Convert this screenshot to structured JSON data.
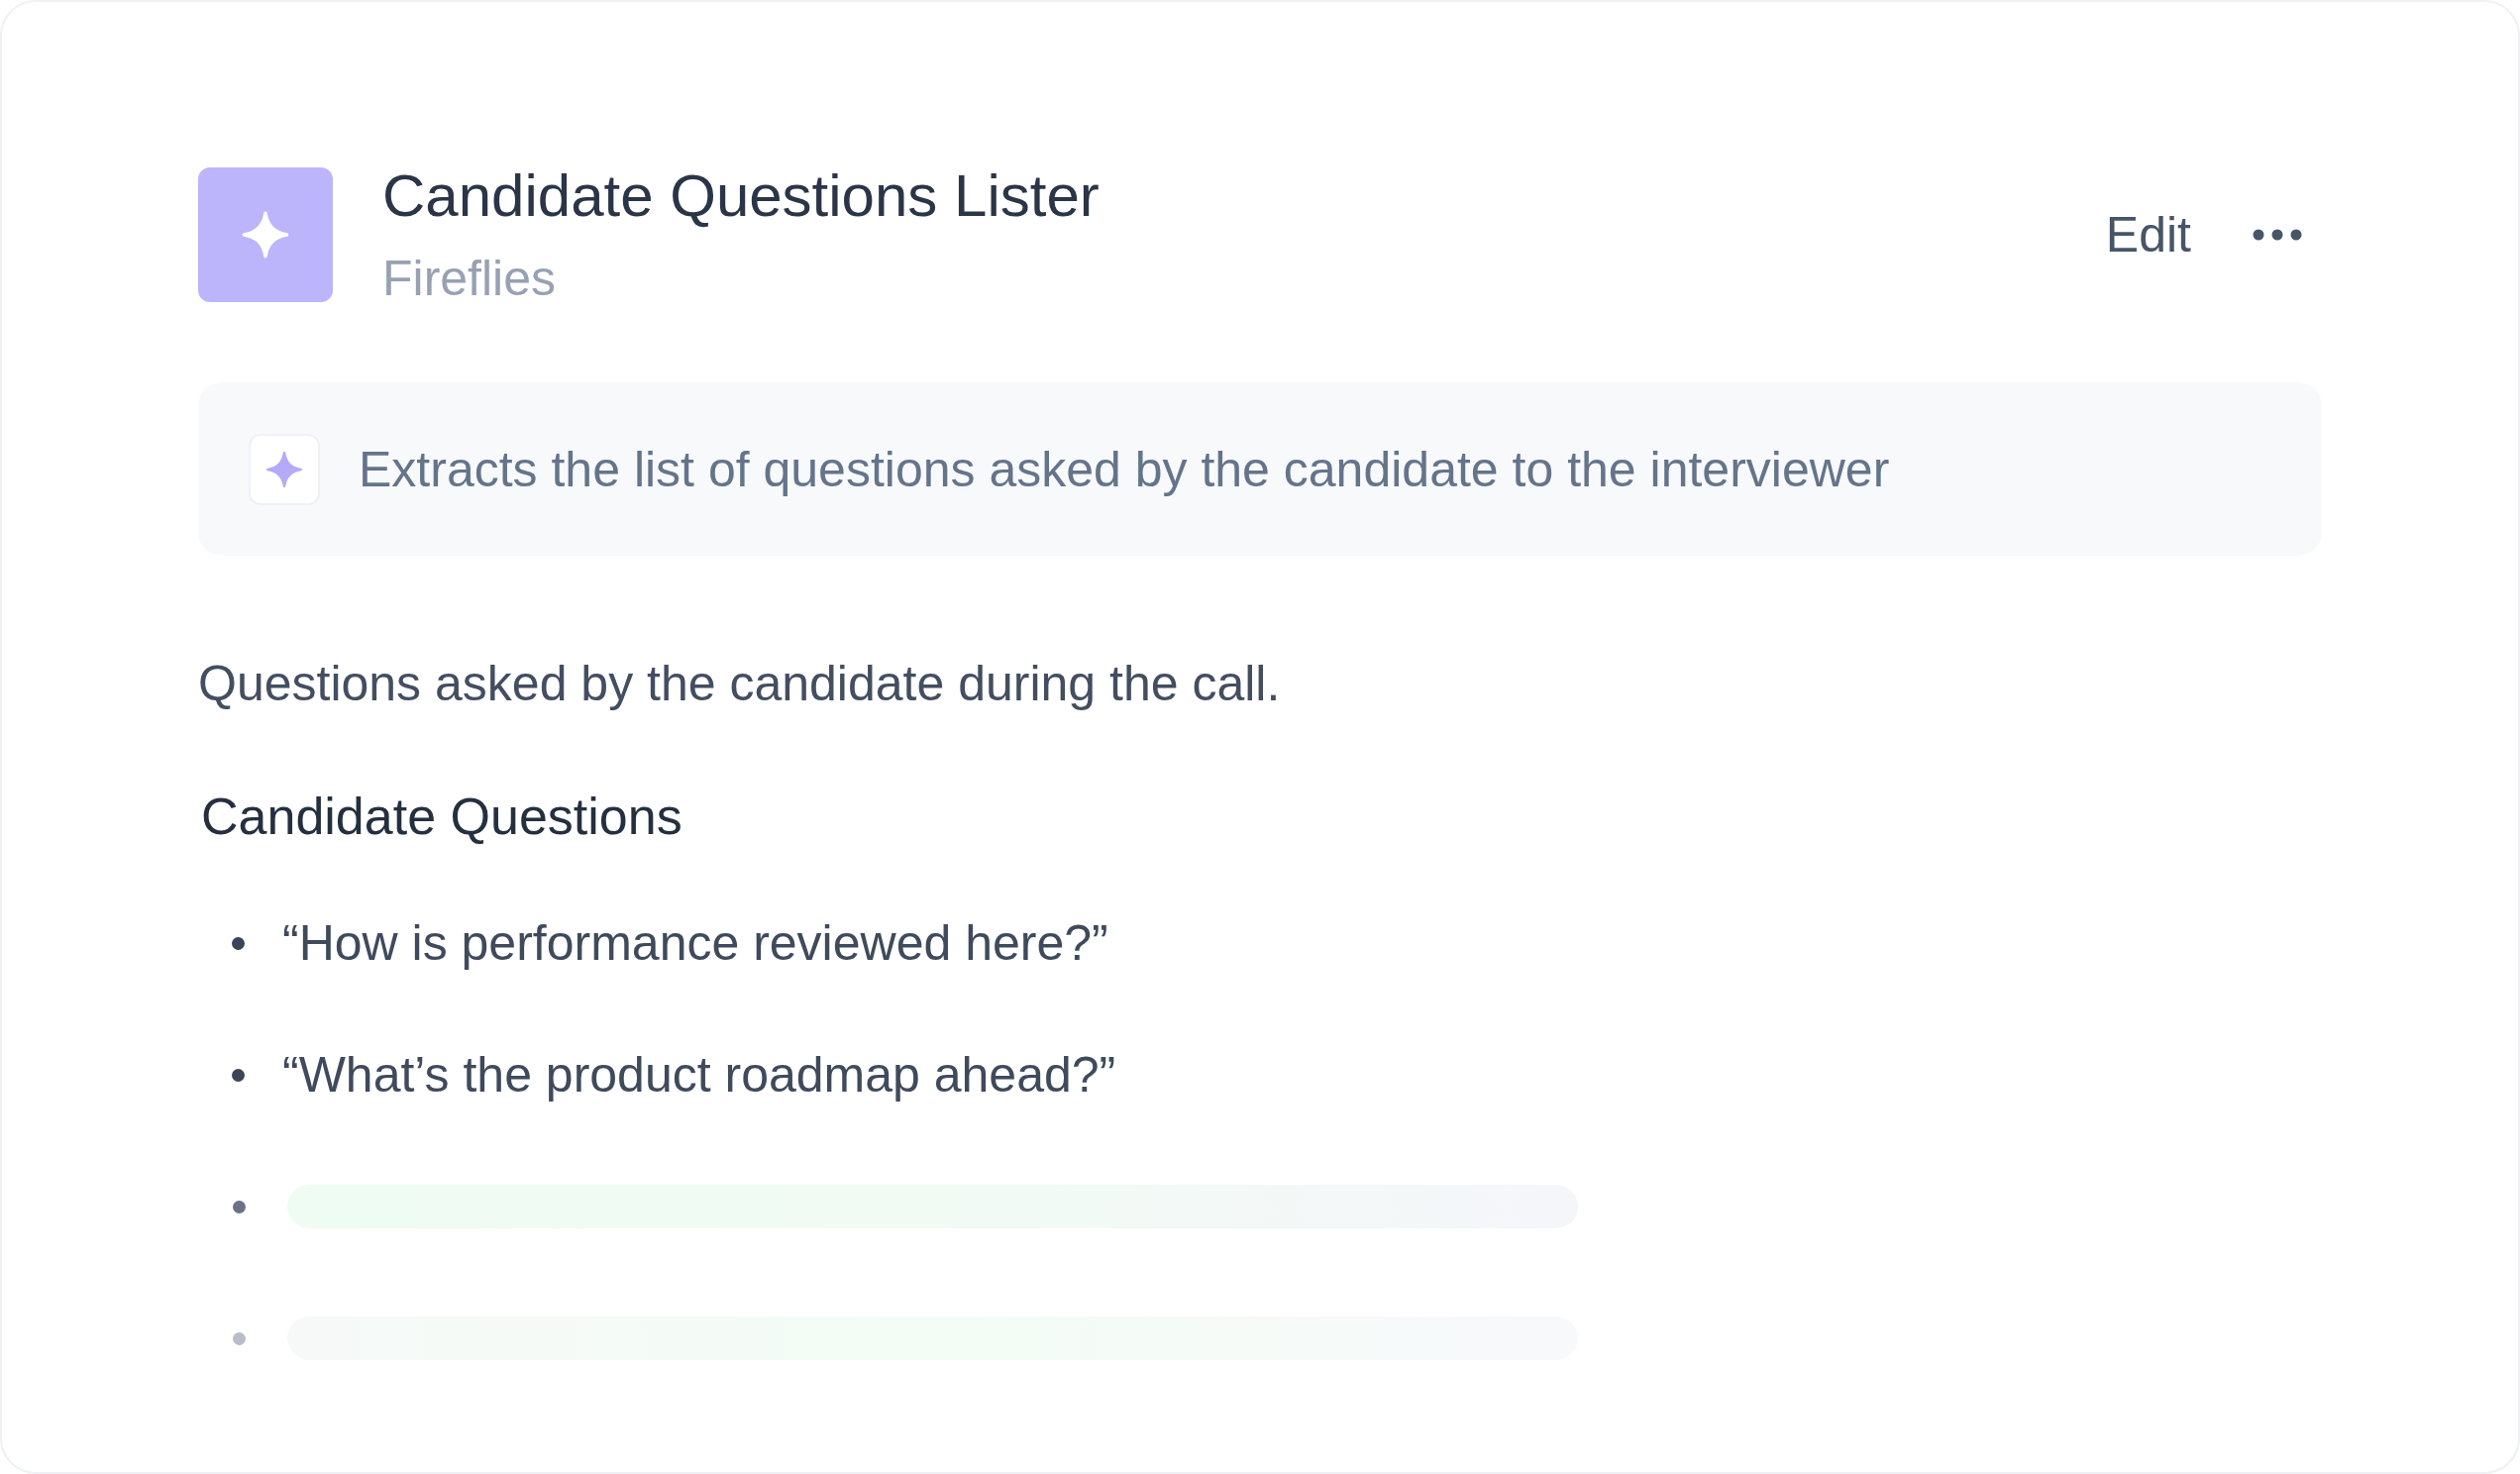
{
  "agent": {
    "title": "Candidate Questions Lister",
    "source": "Fireflies"
  },
  "header_actions": {
    "edit_label": "Edit"
  },
  "summary": "Extracts the list of questions asked by the candidate to the interviewer",
  "description": "Questions asked by the candidate during the call.",
  "section": {
    "heading": "Candidate Questions",
    "items": [
      {
        "kind": "question",
        "text": "“How is performance reviewed here?”"
      },
      {
        "kind": "question",
        "text": "“What’s the product roadmap ahead?”"
      },
      {
        "kind": "loading"
      },
      {
        "kind": "loading"
      }
    ]
  }
}
